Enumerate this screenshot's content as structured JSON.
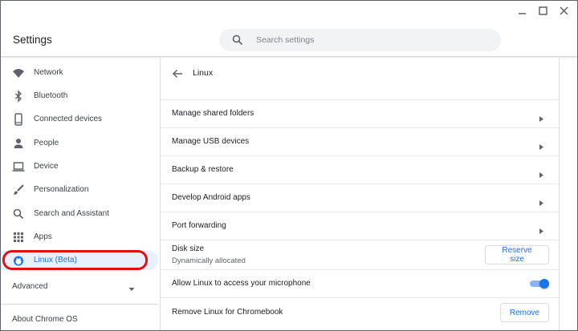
{
  "app": {
    "title": "Settings"
  },
  "search": {
    "placeholder": "Search settings",
    "value": ""
  },
  "window_controls": {
    "minimize_icon": "minimize-icon",
    "maximize_icon": "maximize-icon",
    "close_icon": "close-icon"
  },
  "sidebar": {
    "items": [
      {
        "label": "Network",
        "icon": "wifi-icon"
      },
      {
        "label": "Bluetooth",
        "icon": "bluetooth-icon"
      },
      {
        "label": "Connected devices",
        "icon": "phone-icon"
      },
      {
        "label": "People",
        "icon": "person-icon"
      },
      {
        "label": "Device",
        "icon": "laptop-icon"
      },
      {
        "label": "Personalization",
        "icon": "brush-icon"
      },
      {
        "label": "Search and Assistant",
        "icon": "search-icon"
      },
      {
        "label": "Apps",
        "icon": "apps-grid-icon"
      },
      {
        "label": "Linux (Beta)",
        "icon": "linux-penguin-icon",
        "active": true
      }
    ],
    "advanced_label": "Advanced",
    "about_label": "About Chrome OS"
  },
  "main": {
    "title": "Linux",
    "rows": [
      {
        "label": "Manage shared folders"
      },
      {
        "label": "Manage USB devices"
      },
      {
        "label": "Backup & restore"
      },
      {
        "label": "Develop Android apps"
      },
      {
        "label": "Port forwarding"
      }
    ],
    "disk": {
      "label": "Disk size",
      "sub": "Dynamically allocated",
      "button": "Reserve size"
    },
    "microphone": {
      "label": "Allow Linux to access your microphone",
      "enabled": true
    },
    "remove": {
      "label": "Remove Linux for Chromebook",
      "button": "Remove"
    }
  },
  "colors": {
    "accent": "#1a73e8",
    "active_bg": "#e8f0fe",
    "highlight": "#e01010"
  }
}
